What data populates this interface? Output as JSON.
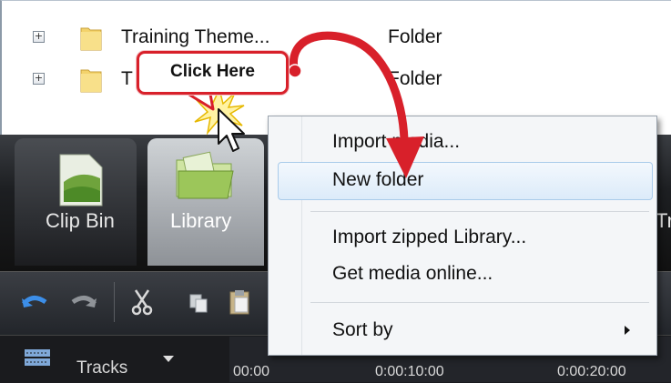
{
  "list": {
    "rows": [
      {
        "expand": "+",
        "name": "Training Theme...",
        "type": "Folder"
      },
      {
        "expand": "+",
        "name": "T",
        "type": "Folder"
      }
    ]
  },
  "tabs": {
    "clip_bin": "Clip Bin",
    "library": "Library",
    "partial_right": "Tr"
  },
  "timeline": {
    "tracks_label": "Tracks",
    "times": [
      "00:00",
      "0:00:10:00",
      "0:00:20:00"
    ]
  },
  "context_menu": {
    "items": [
      {
        "label": "Import media..."
      },
      {
        "label": "New folder",
        "highlighted": true
      },
      {
        "label": "Import zipped Library..."
      },
      {
        "label": "Get media online..."
      },
      {
        "label": "Sort by",
        "submenu": true
      }
    ]
  },
  "callout": {
    "text": "Click Here",
    "border_color": "#d8202a"
  },
  "colors": {
    "annotation_arrow": "#d8202a",
    "menu_highlight": "#dcebf9"
  },
  "icons": [
    "expand-plus-icon",
    "folder-icon",
    "clip-bin-icon",
    "library-icon",
    "undo-icon",
    "redo-icon",
    "cut-icon",
    "copy-icon",
    "paste-icon",
    "tracks-icon",
    "dropdown-arrow-icon",
    "submenu-arrow-icon",
    "mouse-cursor-icon",
    "click-burst-icon"
  ]
}
